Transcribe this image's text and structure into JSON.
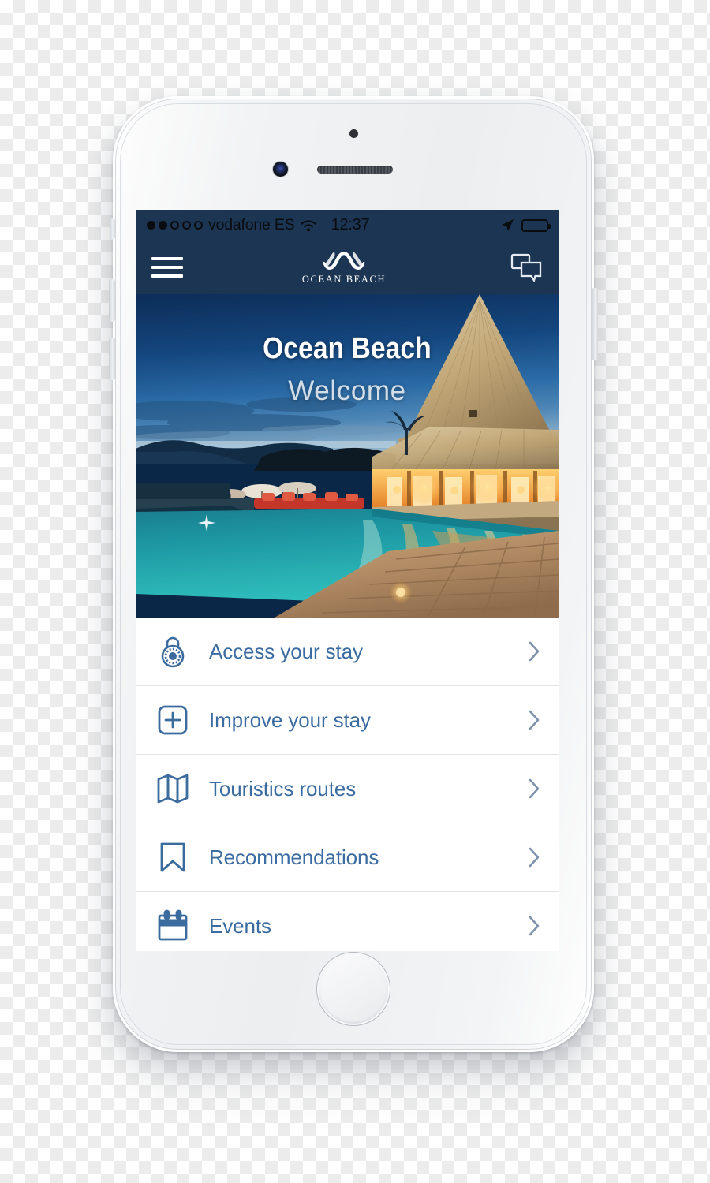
{
  "device": {
    "name": "iphone-6-silver",
    "hardware": {
      "sensor": "proximity-sensor",
      "camera": "front-camera",
      "speaker": "earpiece-speaker",
      "home": "home-button",
      "silent_switch": "silent-switch",
      "volume_up": "volume-up-button",
      "volume_down": "volume-down-button",
      "power": "power-button"
    }
  },
  "status_bar": {
    "signal_bars_filled": 2,
    "signal_bars_total": 5,
    "carrier": "vodafone ES",
    "wifi_icon": "wifi-icon",
    "time": "12:37",
    "location_icon": "location-arrow-icon",
    "battery_icon": "battery-icon",
    "battery_level_pct": 100
  },
  "nav_bar": {
    "menu_icon": "hamburger-menu-icon",
    "brand_mark": "ocean-beach-wave-logo",
    "brand_name": "OCEAN BEACH",
    "chat_icon": "chat-bubbles-icon",
    "background_color": "#1b3553"
  },
  "hero": {
    "title": "Ocean Beach",
    "subtitle": "Welcome",
    "image_alt": "tropical-resort-pool-at-dusk"
  },
  "menu": {
    "items": [
      {
        "label": "Access your stay",
        "icon": "padlock-icon",
        "chevron": "chevron-right-icon"
      },
      {
        "label": "Improve your stay",
        "icon": "plus-box-icon",
        "chevron": "chevron-right-icon"
      },
      {
        "label": "Touristics routes",
        "icon": "map-icon",
        "chevron": "chevron-right-icon"
      },
      {
        "label": "Recommendations",
        "icon": "bookmark-icon",
        "chevron": "chevron-right-icon"
      },
      {
        "label": "Events",
        "icon": "calendar-icon",
        "chevron": "chevron-right-icon"
      }
    ]
  },
  "colors": {
    "navy": "#1b3553",
    "link_blue": "#3b6ca1",
    "icon_blue": "#3c6b9e",
    "chevron_grey": "#7e93ab",
    "divider": "#e2e5e8"
  }
}
